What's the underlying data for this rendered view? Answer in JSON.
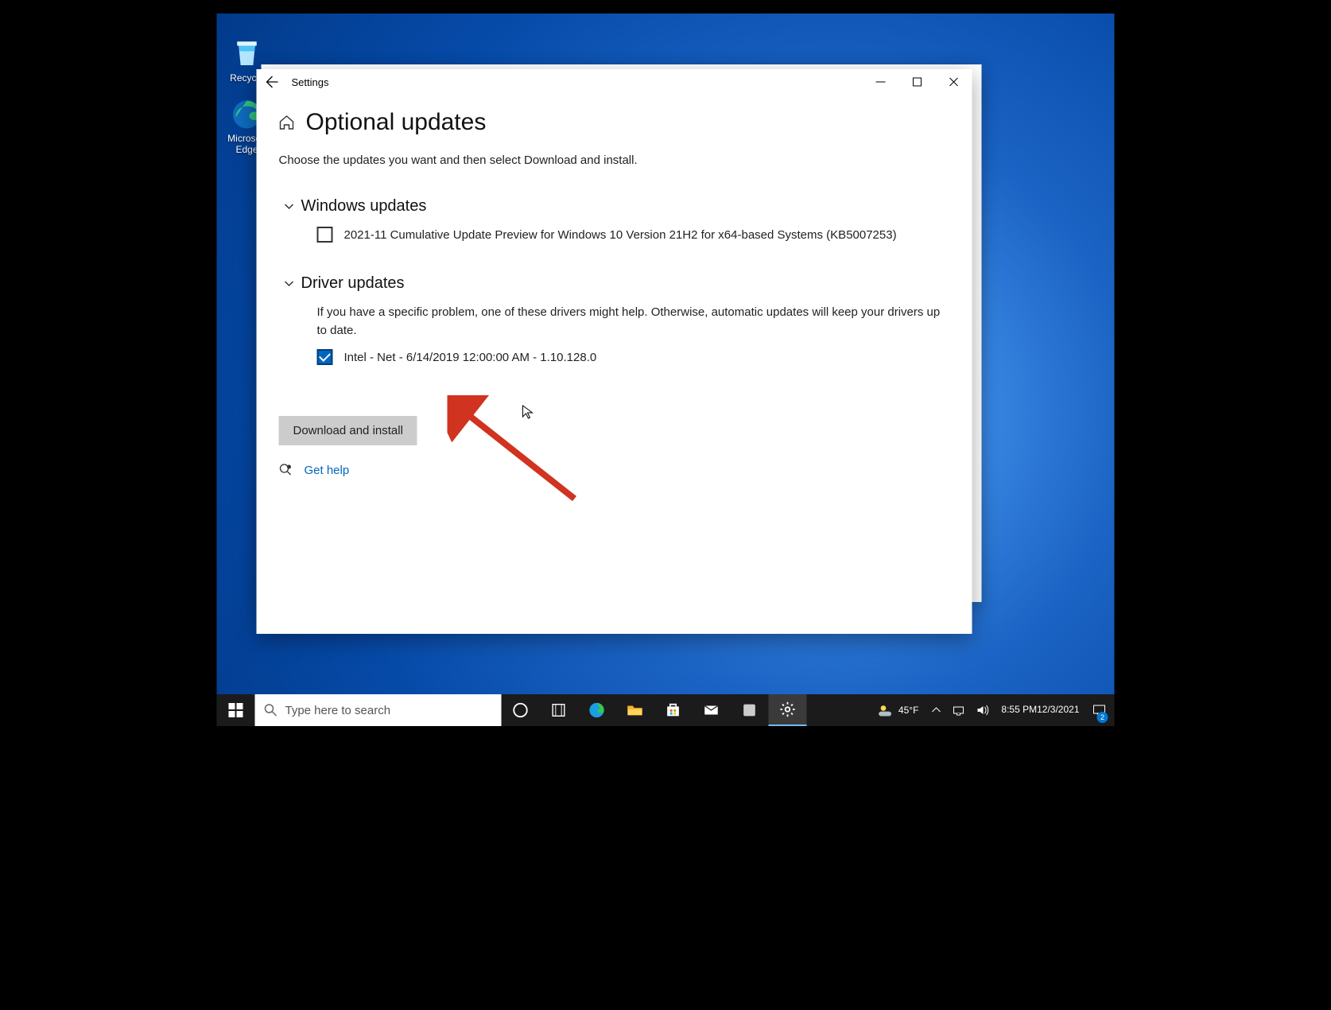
{
  "desktop": {
    "icons": [
      {
        "name": "recycle-bin",
        "label": "Recycle"
      },
      {
        "name": "edge",
        "label": "Microsoft Edge"
      }
    ]
  },
  "window": {
    "app_title": "Settings",
    "page_title": "Optional updates",
    "instruction": "Choose the updates you want and then select Download and install.",
    "sections": {
      "windows": {
        "title": "Windows updates",
        "items": [
          {
            "label": "2021-11 Cumulative Update Preview for Windows 10 Version 21H2 for x64-based Systems (KB5007253)",
            "checked": false
          }
        ]
      },
      "drivers": {
        "title": "Driver updates",
        "note": "If you have a specific problem, one of these drivers might help. Otherwise, automatic updates will keep your drivers up to date.",
        "items": [
          {
            "label": "Intel - Net - 6/14/2019 12:00:00 AM - 1.10.128.0",
            "checked": true
          }
        ]
      }
    },
    "action_button": "Download and install",
    "help_link": "Get help"
  },
  "taskbar": {
    "search_placeholder": "Type here to search",
    "weather_temp": "45°F",
    "clock_time": "8:55 PM",
    "clock_date": "12/3/2021"
  }
}
